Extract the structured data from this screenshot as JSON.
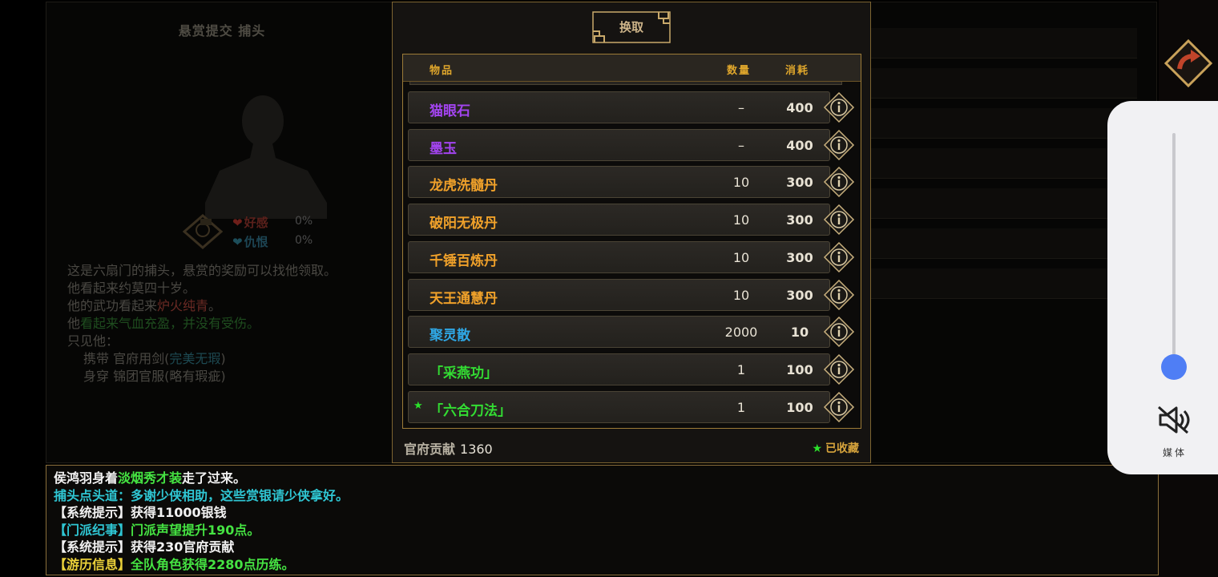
{
  "npc": {
    "title": "悬赏提交  捕头",
    "affection_label": "好感",
    "affection_value": "0%",
    "hatred_label": "仇恨",
    "hatred_value": "0%",
    "desc_line1": "这是六扇门的捕头，悬赏的奖励可以找他领取。",
    "desc_line2": "他看起来约莫四十岁。",
    "desc_line3_prefix": "他的武功看起来",
    "desc_line3_highlight": "炉火纯青",
    "desc_line3_suffix": "。",
    "desc_line4_prefix": "他",
    "desc_line4_highlight": "看起来气血充盈，并没有受伤。",
    "desc_line5": "只见他：",
    "desc_carry_prefix": "携带  官府用剑(",
    "desc_carry_highlight": "完美无瑕",
    "desc_carry_suffix": ")",
    "desc_wear": "身穿  锦团官服(略有瑕疵)"
  },
  "exchange": {
    "title": "换取",
    "col_item": "物品",
    "col_qty": "数量",
    "col_cost": "消耗",
    "items": [
      {
        "name": "猫眼石",
        "qty": "–",
        "cost": "400",
        "color": "#a344f0",
        "favorite": false
      },
      {
        "name": "墨玉",
        "qty": "–",
        "cost": "400",
        "color": "#a344f0",
        "favorite": false
      },
      {
        "name": "龙虎洗髓丹",
        "qty": "10",
        "cost": "300",
        "color": "#f0a12a",
        "favorite": false
      },
      {
        "name": "破阳无极丹",
        "qty": "10",
        "cost": "300",
        "color": "#f0a12a",
        "favorite": false
      },
      {
        "name": "千锤百炼丹",
        "qty": "10",
        "cost": "300",
        "color": "#f0a12a",
        "favorite": false
      },
      {
        "name": "天王通慧丹",
        "qty": "10",
        "cost": "300",
        "color": "#f0a12a",
        "favorite": false
      },
      {
        "name": "聚灵散",
        "qty": "2000",
        "cost": "10",
        "color": "#2fa8e6",
        "favorite": false
      },
      {
        "name": "「采燕功」",
        "qty": "1",
        "cost": "100",
        "color": "#33dd33",
        "favorite": false
      },
      {
        "name": "「六合刀法」",
        "qty": "1",
        "cost": "100",
        "color": "#33dd33",
        "favorite": true
      }
    ],
    "contribution_label": "官府贡献",
    "contribution_value": "1360",
    "favorites_label": "已收藏"
  },
  "log": {
    "line1_a": "侯鸿羽身着",
    "line1_b": "淡烟秀才装",
    "line1_c": "走了过来。",
    "line2": "捕头点头道：多谢少侠相助，这些赏银请少侠拿好。",
    "line3_tag": "【系统提示】",
    "line3_text": "获得11000银钱",
    "line4_tag": "【门派纪事】",
    "line4_text": "门派声望提升190点。",
    "line5_tag": "【系统提示】",
    "line5_text": "获得230官府贡献",
    "line6_tag": "【游历信息】",
    "line6_text": "全队角色获得2280点历练。"
  },
  "volume": {
    "label": "媒体",
    "level": 0.07,
    "icon": "speaker-muted-icon"
  },
  "colors": {
    "accent_gold": "#e0a72c",
    "panel_border": "#9c7b37"
  }
}
